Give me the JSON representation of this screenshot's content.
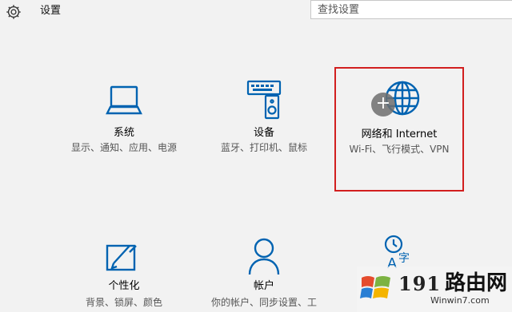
{
  "titlebar": {
    "title": "设置"
  },
  "search": {
    "placeholder": "查找设置"
  },
  "tiles": [
    {
      "name": "系统",
      "desc": "显示、通知、应用、电源",
      "icon": "laptop-icon"
    },
    {
      "name": "设备",
      "desc": "蓝牙、打印机、鼠标",
      "icon": "devices-icon"
    },
    {
      "name": "网络和 Internet",
      "desc": "Wi-Fi、飞行模式、VPN",
      "icon": "globe-icon"
    },
    {
      "name": "个性化",
      "desc": "背景、锁屏、颜色",
      "icon": "personalization-icon"
    },
    {
      "name": "帐户",
      "desc": "你的帐户、同步设置、工",
      "icon": "account-icon"
    },
    {
      "name": "",
      "desc": "",
      "icon": "time-language-icon"
    }
  ],
  "watermark": {
    "number": "191",
    "brand": "路由网",
    "url": "Winwin7.com",
    "logo": "windows-logo-icon"
  },
  "colors": {
    "accent": "#0063b1",
    "highlight_border": "#d21f1f",
    "background": "#f2f2f2"
  }
}
